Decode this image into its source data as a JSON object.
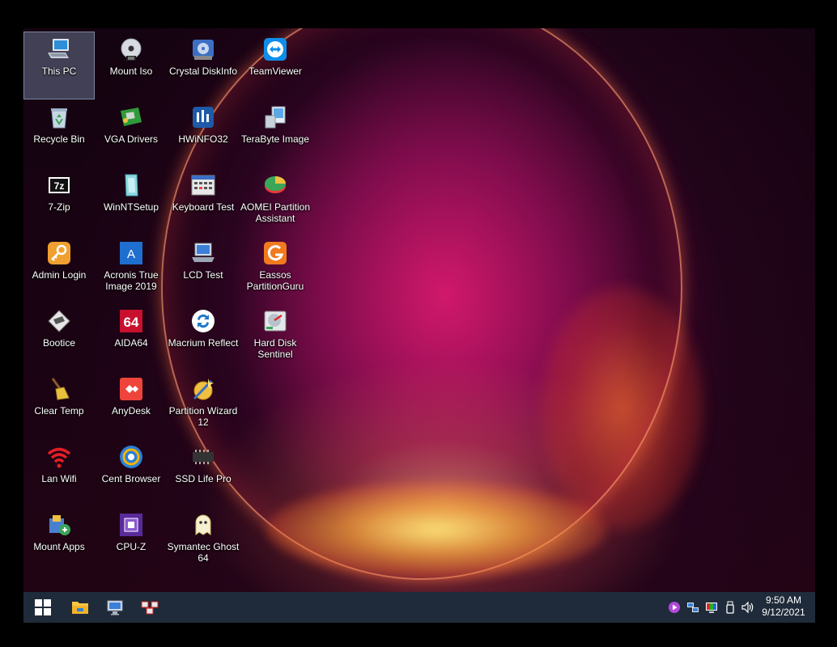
{
  "desktop": {
    "icons": [
      {
        "id": "this-pc",
        "label": "This PC"
      },
      {
        "id": "mount-iso",
        "label": "Mount Iso"
      },
      {
        "id": "crystal-diskinfo",
        "label": "Crystal DiskInfo"
      },
      {
        "id": "teamviewer",
        "label": "TeamViewer"
      },
      {
        "id": "recycle-bin",
        "label": "Recycle Bin"
      },
      {
        "id": "vga-drivers",
        "label": "VGA Drivers"
      },
      {
        "id": "hwinfo32",
        "label": "HWiNFO32"
      },
      {
        "id": "terabyte-image",
        "label": "TeraByte Image"
      },
      {
        "id": "7-zip",
        "label": "7-Zip"
      },
      {
        "id": "winntsetup",
        "label": "WinNTSetup"
      },
      {
        "id": "keyboard-test",
        "label": "Keyboard Test"
      },
      {
        "id": "aomei-partition-assistant",
        "label": "AOMEI Partition Assistant"
      },
      {
        "id": "admin-login",
        "label": "Admin Login"
      },
      {
        "id": "acronis-true-image-2019",
        "label": "Acronis True Image 2019"
      },
      {
        "id": "lcd-test",
        "label": "LCD Test"
      },
      {
        "id": "eassos-partitionguru",
        "label": "Eassos PartitionGuru"
      },
      {
        "id": "bootice",
        "label": "Bootice"
      },
      {
        "id": "aida64",
        "label": "AIDA64"
      },
      {
        "id": "macrium-reflect",
        "label": "Macrium Reflect"
      },
      {
        "id": "hard-disk-sentinel",
        "label": "Hard Disk Sentinel"
      },
      {
        "id": "clear-temp",
        "label": "Clear Temp"
      },
      {
        "id": "anydesk",
        "label": "AnyDesk"
      },
      {
        "id": "partition-wizard-12",
        "label": "Partition Wizard 12"
      },
      {
        "id": "lan-wifi",
        "label": "Lan Wifi"
      },
      {
        "id": "cent-browser",
        "label": "Cent Browser"
      },
      {
        "id": "ssd-life-pro",
        "label": "SSD Life Pro"
      },
      {
        "id": "mount-apps",
        "label": "Mount Apps"
      },
      {
        "id": "cpu-z",
        "label": "CPU-Z"
      },
      {
        "id": "symantec-ghost-64",
        "label": "Symantec Ghost 64"
      }
    ],
    "selected_icon": "This PC",
    "aida_text": "64",
    "acronis_text": "A",
    "sevenzip_text": "7z"
  },
  "taskbar": {
    "pinned": [
      {
        "id": "start",
        "icon": "windows-logo-icon"
      },
      {
        "id": "file-explorer",
        "icon": "folder-icon"
      },
      {
        "id": "remote-desktop",
        "icon": "monitor-network-icon"
      },
      {
        "id": "app-tool",
        "icon": "network-tool-icon"
      }
    ],
    "tray": [
      {
        "id": "media",
        "icon": "media-play-icon"
      },
      {
        "id": "network",
        "icon": "network-icon"
      },
      {
        "id": "display",
        "icon": "display-color-icon"
      },
      {
        "id": "usb",
        "icon": "usb-icon"
      },
      {
        "id": "volume",
        "icon": "volume-icon"
      }
    ],
    "clock": {
      "time": "9:50 AM",
      "date": "9/12/2021"
    }
  },
  "colors": {
    "taskbar": "#1f2b3a",
    "selection": "#7f8fa8",
    "wallpaper_core": "#d7196e",
    "wallpaper_glow": "#ffd860"
  }
}
